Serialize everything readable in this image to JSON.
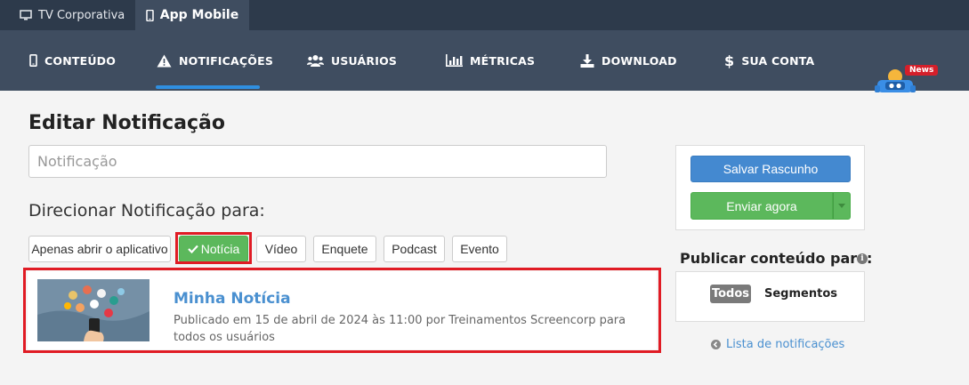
{
  "top_tabs": [
    {
      "label": "TV Corporativa",
      "icon": "monitor-icon"
    },
    {
      "label": "App Mobile",
      "icon": "smartphone-icon",
      "active": true
    }
  ],
  "nav": {
    "items": [
      {
        "label": "CONTEÚDO",
        "icon": "mobile-icon"
      },
      {
        "label": "NOTIFICAÇÕES",
        "icon": "warning-icon",
        "active": true
      },
      {
        "label": "USUÁRIOS",
        "icon": "users-icon"
      },
      {
        "label": "MÉTRICAS",
        "icon": "bar-chart-icon"
      },
      {
        "label": "DOWNLOAD",
        "icon": "download-icon"
      },
      {
        "label": "SUA CONTA",
        "icon": "dollar-icon"
      }
    ],
    "news_badge": "News"
  },
  "page": {
    "title": "Editar Notificação",
    "input_placeholder": "Notificação",
    "target_heading": "Direcionar Notificação para:",
    "type_buttons": [
      {
        "label": "Apenas abrir o aplicativo"
      },
      {
        "label": "Notícia",
        "active": true
      },
      {
        "label": "Vídeo"
      },
      {
        "label": "Enquete"
      },
      {
        "label": "Podcast"
      },
      {
        "label": "Evento"
      }
    ],
    "selected_item": {
      "title": "Minha Notícia",
      "meta": "Publicado em 15 de abril de 2024 às 11:00 por Treinamentos Screencorp para todos os usuários"
    }
  },
  "sidebar": {
    "save_label": "Salvar Rascunho",
    "send_label": "Enviar agora",
    "publish_heading": "Publicar conteúdo para:",
    "audience": {
      "all": "Todos",
      "segments": "Segmentos",
      "selected": "Todos"
    },
    "list_link": "Lista de notificações"
  },
  "colors": {
    "topbar": "#2d3a4b",
    "nav": "#3f4d60",
    "accent_blue": "#4489d0",
    "success_green": "#5cb85c",
    "highlight_red": "#e01b24"
  }
}
